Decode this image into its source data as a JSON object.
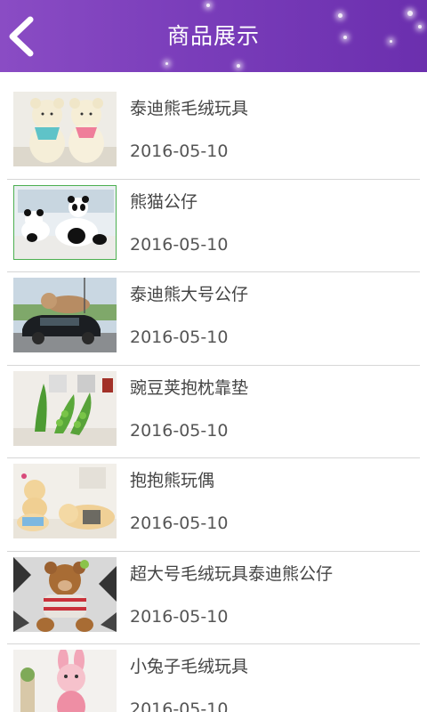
{
  "header": {
    "title": "商品展示",
    "back_icon": "chevron-left-icon",
    "accent_color": "#7a3dba"
  },
  "products": [
    {
      "name": "泰迪熊毛绒玩具",
      "date": "2016-05-10",
      "image": "teddy-bears-pair"
    },
    {
      "name": "熊猫公仔",
      "date": "2016-05-10",
      "image": "panda-plush"
    },
    {
      "name": "泰迪熊大号公仔",
      "date": "2016-05-10",
      "image": "giant-teddy-on-car"
    },
    {
      "name": "豌豆荚抱枕靠垫",
      "date": "2016-05-10",
      "image": "pea-pod-pillows"
    },
    {
      "name": "抱抱熊玩偶",
      "date": "2016-05-10",
      "image": "lying-bears"
    },
    {
      "name": "超大号毛绒玩具泰迪熊公仔",
      "date": "2016-05-10",
      "image": "teddy-in-sweater"
    },
    {
      "name": "小兔子毛绒玩具",
      "date": "2016-05-10",
      "image": "pink-rabbit-plush"
    }
  ]
}
